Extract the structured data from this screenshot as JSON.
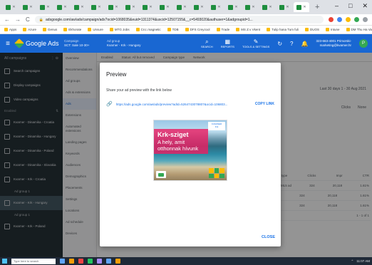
{
  "browser": {
    "tab_count": 18,
    "new_tab_label": "+",
    "window_controls": [
      "–",
      "□",
      "✕"
    ],
    "url": "adsgoogle.com/aw/ads/campaign/ads?ocid=1068035&euid=1311374&uscid=12507155&__c=5493020&authuser=1&adgroupid=1...",
    "nav": [
      "←",
      "→",
      "C"
    ],
    "bookmarks": [
      "Apps",
      "Azure",
      "Genus",
      "Ekhorate",
      "Unsure",
      "MTG Jobs",
      "Cro:.magnetic",
      "TDB",
      "DFS Crey.tool",
      "Trade",
      "MS Z.v Vkent",
      "Tulip hana Tum fuli",
      "DUOS",
      "Intune",
      "DM Thu Ha Vary Sta..."
    ]
  },
  "appbar": {
    "product": "Google Ads",
    "crumb_top": "Campaign",
    "crumb_bottom": "SCT: Sale 10-30+",
    "crumb2_top": "Ad group",
    "crumb2_bottom": "Kvarner - Krk - Hungary",
    "tools": [
      {
        "glyph": "⌕",
        "label": "SEARCH"
      },
      {
        "glyph": "▦",
        "label": "REPORTS"
      },
      {
        "glyph": "✎",
        "label": "TOOLS & SETTINGS"
      }
    ],
    "account_line1": "323-663-4001 Primorski-",
    "account_line2": "marketing@kvarner.hr",
    "avatar_letter": "P"
  },
  "leftnav": {
    "header": "All campaigns",
    "items": [
      {
        "label": "Search campaigns"
      },
      {
        "label": "Display campaigns"
      },
      {
        "label": "Video campaigns"
      }
    ],
    "section": "Enabled",
    "campaigns": [
      {
        "label": "Kvarner - Dinamika - Croatia"
      },
      {
        "label": "Kvarner - Dinamika - Hungary"
      },
      {
        "label": "Kvarner - Dinamika - Poland"
      },
      {
        "label": "Kvarner - Dinamika - Slovakia"
      },
      {
        "label": "Kvarner - Krk - Croatia"
      },
      {
        "label": "Kvarner - Krk - Hungary"
      },
      {
        "label": "Kvarner - Krk - Poland"
      }
    ],
    "adgroup_label": "Ad group 1"
  },
  "subnav": {
    "items": [
      "Overview",
      "Recommendations",
      "Ad groups",
      "Ads & extensions",
      "Ads",
      "Extensions",
      "Automated extensions",
      "Landing pages",
      "Keywords",
      "Audiences",
      "Demographics",
      "Placements",
      "Settings",
      "Locations",
      "Ad schedule",
      "Devices"
    ]
  },
  "main": {
    "tabs": [
      "Enabled",
      "Status: All but removed",
      "Campaign type",
      "Network"
    ],
    "date_range": "Last 30 days  1 - 30 Aug 2021",
    "filters": [
      "Clicks",
      "None"
    ],
    "columns": [
      "Ad type",
      "Clicks",
      "Impr",
      "CTR"
    ],
    "rows": [
      [
        "HTML5 ad",
        "324",
        "20,118",
        "1.61%"
      ],
      [
        "",
        "324",
        "20,118",
        "1.61%"
      ],
      [
        "",
        "324",
        "20,118",
        "1.61%"
      ]
    ],
    "pagination": "1 - 1 of 1"
  },
  "modal": {
    "title": "Preview",
    "description": "Share your ad preview with the link below",
    "link": "https://ads.google.com/aw/ads/preview?adId=5264743078807&ocid=106803...",
    "copy_label": "COPY LINK",
    "close_label": "CLOSE",
    "ad": {
      "headline": "Krk-sziget",
      "tagline_1": "A hely, amit",
      "tagline_2": "otthonnak hívunk",
      "brand_tr": "KVARNER",
      "brand_tr_sub": "Krk"
    }
  },
  "taskbar": {
    "search_placeholder": "Type here to search",
    "clock": "11:07 AM"
  }
}
